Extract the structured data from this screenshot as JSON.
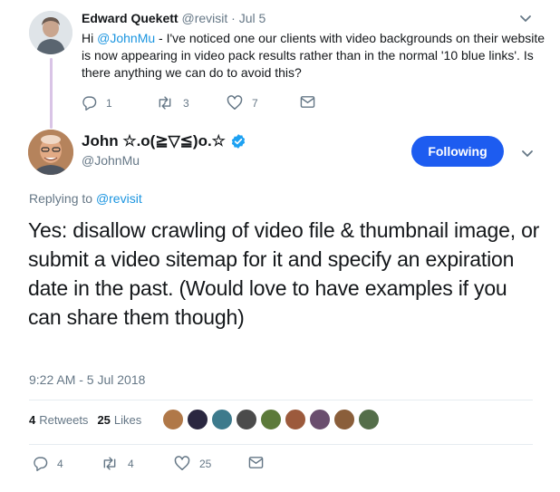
{
  "parent": {
    "author_name": "Edward Quekett",
    "handle": "@revisit",
    "separator": "·",
    "date": "Jul 5",
    "text_pre": "Hi ",
    "mention": "@JohnMu",
    "text_post": " - I've noticed one our clients with video backgrounds on their website is now appearing in video pack results rather than in the normal '10 blue links'. Is there anything we can do to avoid this?",
    "reply_count": "1",
    "retweet_count": "3",
    "like_count": "7"
  },
  "main": {
    "author_name": "John ☆.o(≧▽≦)o.☆",
    "handle": "@JohnMu",
    "follow_label": "Following",
    "replying_prefix": "Replying to ",
    "replying_handle": "@revisit",
    "text": "Yes: disallow crawling of video file & thumbnail image, or submit a video sitemap for it and specify an expiration date in the past. (Would love to have examples if you can share them though)",
    "timestamp": "9:22 AM - 5 Jul 2018",
    "retweets_count": "4",
    "retweets_label": "Retweets",
    "likes_count": "25",
    "likes_label": "Likes",
    "reply_count": "4",
    "retweet_count": "4",
    "like_count": "25"
  },
  "colors": {
    "accent": "#1d5cf0",
    "link": "#1b95e0",
    "muted": "#657786",
    "thread_line": "#d9c4e6"
  },
  "likers": [
    {
      "color": "#b07848"
    },
    {
      "color": "#2a2740"
    },
    {
      "color": "#3d7a8c"
    },
    {
      "color": "#4b4b4b"
    },
    {
      "color": "#5c7a3a"
    },
    {
      "color": "#9c5a3c"
    },
    {
      "color": "#6a4e6e"
    },
    {
      "color": "#8a5e3a"
    },
    {
      "color": "#546e4a"
    }
  ]
}
